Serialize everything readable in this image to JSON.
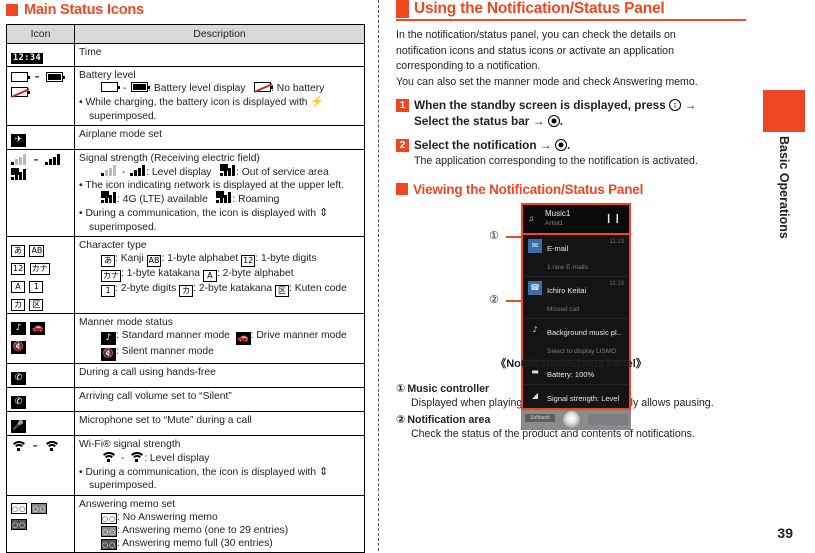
{
  "left": {
    "section_title": "Main Status Icons",
    "table": {
      "headers": [
        "Icon",
        "Description"
      ],
      "rows": [
        {
          "desc_title": "Time",
          "lines": []
        },
        {
          "desc_title": "Battery level",
          "lines": [
            ": Battery level display",
            ": No battery",
            "While charging, the battery icon is displayed with",
            "superimposed."
          ]
        },
        {
          "desc_title": "Airplane mode set",
          "lines": []
        },
        {
          "desc_title": "Signal strength (Receiving electric field)",
          "lines": [
            ": Level display",
            ": Out of service area",
            "The icon indicating network is displayed at the upper left.",
            ": 4G (LTE) available",
            ": Roaming",
            "During a communication, the icon is displayed with",
            "superimposed."
          ]
        },
        {
          "desc_title": "Character type",
          "lines": [
            ": Kanji",
            ": 1-byte alphabet",
            ": 1-byte digits",
            ": 1-byte katakana",
            ": 2-byte alphabet",
            ": 2-byte digits",
            ": 2-byte katakana",
            ": Kuten code"
          ]
        },
        {
          "desc_title": "Manner mode status",
          "lines": [
            ": Standard manner mode",
            ": Drive manner mode",
            ": Silent manner mode"
          ]
        },
        {
          "desc_title": "During a call using hands-free",
          "lines": []
        },
        {
          "desc_title": "Arriving call volume set to “Silent”",
          "lines": []
        },
        {
          "desc_title": "Microphone set to “Mute” during a call",
          "lines": []
        },
        {
          "desc_title": "Wi-Fi® signal strength",
          "lines": [
            ": Level display",
            "During a communication, the icon is displayed with",
            "superimposed."
          ]
        },
        {
          "desc_title": "Answering memo set",
          "lines": [
            ": No Answering memo",
            ": Answering memo (one to 29 entries)",
            ": Answering memo full (30 entries)"
          ]
        }
      ]
    },
    "time_icon_text": "12:34",
    "char_glyphs": {
      "kanji": "あ",
      "alpha1": "AB",
      "digit1": "12",
      "kana1": "カナ",
      "alpha2": "A",
      "digit2": "1",
      "kana2": "カ",
      "kuten": "区"
    }
  },
  "right": {
    "section_title": "Using the Notification/Status Panel",
    "intro": [
      "In the notification/status panel, you can check the details on",
      "notification icons and status icons or activate an application",
      "corresponding to a notification.",
      "You can also set the manner mode and check Answering memo."
    ],
    "steps": [
      {
        "num": "1",
        "title_a": "When the standby screen is displayed, press",
        "title_b": "→",
        "title_c": "Select the status bar →",
        "title_d": ".",
        "sub": ""
      },
      {
        "num": "2",
        "title_a": "Select the notification →",
        "title_b": "",
        "title_c": "",
        "title_d": ".",
        "sub": "The application corresponding to the notification is activated."
      }
    ],
    "sub_section_title": "Viewing the Notification/Status Panel",
    "figure": {
      "caption": "《Notification/Status Panel》",
      "callout_1": "①",
      "callout_2": "②",
      "music": {
        "title": "Music1",
        "artist": "Artist1",
        "pause_icon": "❙❙"
      },
      "notifications": [
        {
          "icon": "✉",
          "title": "E-mail",
          "sub": "1 new E-mails",
          "time": "11:13"
        },
        {
          "icon": "☎",
          "title": "Ichiro Keitai",
          "sub": "Missed call",
          "time": "11:19"
        },
        {
          "icon": "♪",
          "title": "Background music pl..",
          "sub": "Select to display LISMO",
          "time": ""
        },
        {
          "icon": "▬",
          "title": "Battery: 100%",
          "sub": "",
          "time": ""
        },
        {
          "icon": "◢",
          "title": "Signal strength: Level",
          "sub": "",
          "time": ""
        }
      ],
      "footer_chip": "Softbank"
    },
    "definitions": [
      {
        "mark": "①",
        "term": "Music controller",
        "desc": "Displayed when playing music with LISMO. Only allows pausing."
      },
      {
        "mark": "②",
        "term": "Notification area",
        "desc": "Check the status of the product and contents of notifications."
      }
    ]
  },
  "sidetab": {
    "label": "Basic Operations"
  },
  "page_number": "39",
  "colors": {
    "accent": "#ef4723",
    "header_bg": "#d9d9d9",
    "text": "#231f20"
  }
}
